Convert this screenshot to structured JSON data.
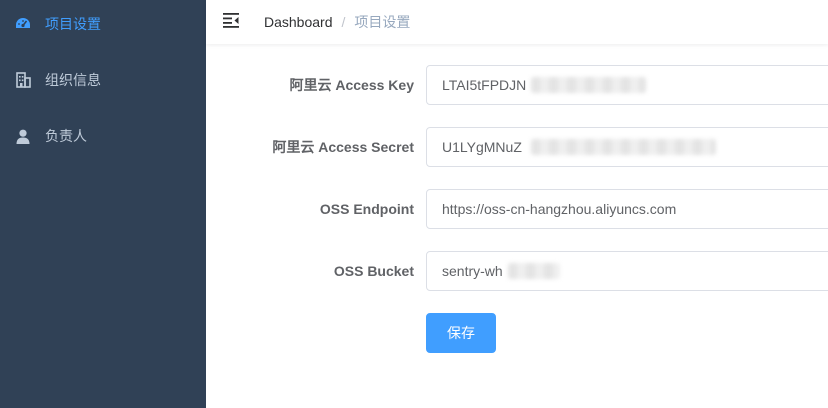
{
  "colors": {
    "sidebar_bg": "#304156",
    "accent": "#409eff",
    "sidebar_text": "#bfcbd9"
  },
  "sidebar": {
    "items": [
      {
        "label": "项目设置",
        "icon": "dashboard-gauge-icon",
        "active": true
      },
      {
        "label": "组织信息",
        "icon": "building-icon",
        "active": false
      },
      {
        "label": "负责人",
        "icon": "user-icon",
        "active": false
      }
    ]
  },
  "navbar": {
    "toggle_icon": "hamburger-icon",
    "breadcrumb": {
      "home": "Dashboard",
      "separator": "/",
      "current": "项目设置"
    }
  },
  "form": {
    "access_key": {
      "label": "阿里云 Access Key",
      "value": "LTAI5tFPDJN"
    },
    "access_secret": {
      "label": "阿里云 Access Secret",
      "value": "U1LYgMNuZ"
    },
    "endpoint": {
      "label": "OSS Endpoint",
      "value": "https://oss-cn-hangzhou.aliyuncs.com"
    },
    "bucket": {
      "label": "OSS Bucket",
      "value": "sentry-wh"
    },
    "save_label": "保存"
  }
}
